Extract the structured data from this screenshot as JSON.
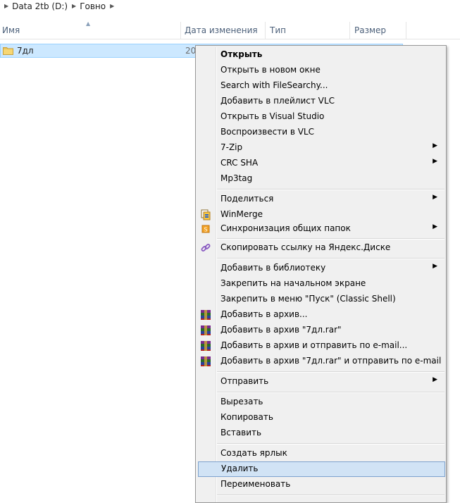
{
  "breadcrumb": {
    "items": [
      "Data 2tb (D:)",
      "Говно"
    ]
  },
  "columns": {
    "name": "Имя",
    "date": "Дата изменения",
    "type": "Тип",
    "size": "Размер"
  },
  "file": {
    "name": "7дл",
    "date": "20"
  },
  "menu": {
    "items": [
      {
        "label": "Открыть",
        "bold": true
      },
      {
        "label": "Открыть в новом окне"
      },
      {
        "label": "Search with FileSearchy..."
      },
      {
        "label": "Добавить в плейлист VLC"
      },
      {
        "label": "Открыть в Visual Studio"
      },
      {
        "label": "Воспроизвести в VLC"
      },
      {
        "label": "7-Zip",
        "submenu": true
      },
      {
        "label": "CRC SHA",
        "submenu": true
      },
      {
        "label": "Mp3tag"
      },
      {
        "label": "Поделиться",
        "submenu": true
      },
      {
        "label": "WinMerge",
        "icon": "winmerge-icon"
      },
      {
        "label": "Синхронизация общих папок",
        "icon": "sync-folders-icon",
        "submenu": true
      },
      {
        "label": "Скопировать ссылку на Яндекс.Диске",
        "icon": "yandex-link-icon"
      },
      {
        "label": "Добавить в библиотеку",
        "submenu": true
      },
      {
        "label": "Закрепить на начальном экране"
      },
      {
        "label": "Закрепить в меню \"Пуск\" (Classic Shell)"
      },
      {
        "label": "Добавить в архив...",
        "icon": "winrar-icon"
      },
      {
        "label": "Добавить в архив \"7дл.rar\"",
        "icon": "winrar-icon"
      },
      {
        "label": "Добавить в архив и отправить по e-mail...",
        "icon": "winrar-icon"
      },
      {
        "label": "Добавить в архив \"7дл.rar\" и отправить по e-mail",
        "icon": "winrar-icon"
      },
      {
        "label": "Отправить",
        "submenu": true
      },
      {
        "label": "Вырезать"
      },
      {
        "label": "Копировать"
      },
      {
        "label": "Вставить"
      },
      {
        "label": "Создать ярлык"
      },
      {
        "label": "Удалить",
        "highlighted": true
      },
      {
        "label": "Переименовать"
      }
    ],
    "submenu_glyph": "▶"
  },
  "colors": {
    "selection": "#cce8ff",
    "menu_bg": "#f0f0f0",
    "menu_highlight": "#d1e3f5"
  }
}
